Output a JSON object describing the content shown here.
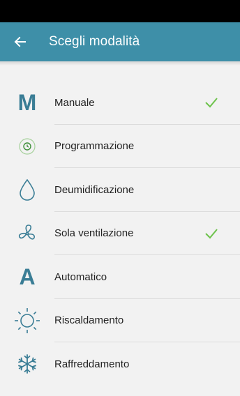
{
  "header": {
    "title": "Scegli modalità",
    "back_icon": "arrow-left-icon"
  },
  "colors": {
    "primary": "#3e8fa8",
    "icon": "#3a7d95",
    "check": "#6cc24a",
    "background": "#f2f2f2"
  },
  "modes": [
    {
      "label": "Manuale",
      "icon": "letter-m-icon",
      "selected": true
    },
    {
      "label": "Programmazione",
      "icon": "clock-schedule-icon",
      "selected": false
    },
    {
      "label": "Deumidificazione",
      "icon": "water-drop-icon",
      "selected": false
    },
    {
      "label": "Sola ventilazione",
      "icon": "fan-icon",
      "selected": true
    },
    {
      "label": "Automatico",
      "icon": "letter-a-icon",
      "selected": false
    },
    {
      "label": "Riscaldamento",
      "icon": "sun-icon",
      "selected": false
    },
    {
      "label": "Raffreddamento",
      "icon": "snowflake-icon",
      "selected": false
    }
  ]
}
